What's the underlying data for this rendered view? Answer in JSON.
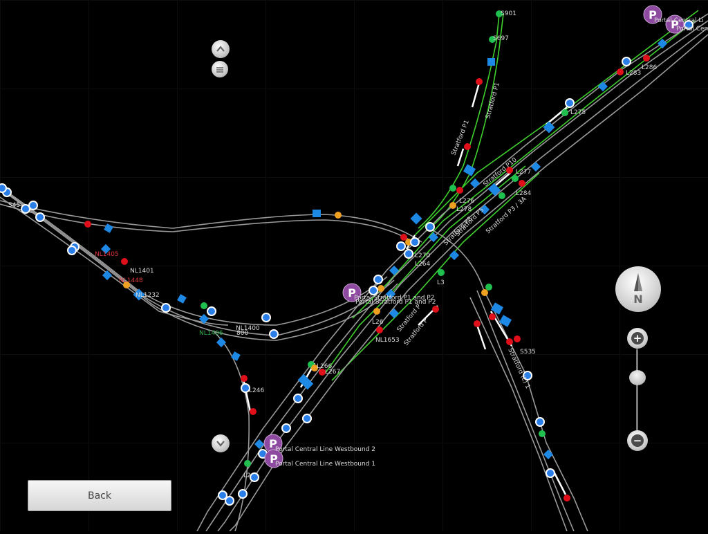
{
  "map": {
    "labels": {
      "s901": "S901",
      "s697": "S697",
      "stratford_p1_a": "Stratford P1",
      "stratford_p1_b": "Stratford P1",
      "l286": "L286",
      "l283": "L283",
      "l275": "L275",
      "l277": "L277",
      "l284": "L284",
      "l276": "L276",
      "l278": "L278",
      "stratford_p10": "Stratford P10",
      "stratford_p8": "Stratford P8",
      "stratford_p5": "Stratford P5",
      "stratford_p3": "Stratford P3 / 3A",
      "l270": "L270",
      "l264": "L264",
      "l3": "L3",
      "portal_stratford_1": "Portal Stratford P1 and P2",
      "portal_stratford_2": "Portal Stratford P1 and P2",
      "l26": "L26",
      "nl1653": "NL1653",
      "stratford_p_low_1": "Stratford P",
      "stratford_p_low_2": "Stratford P",
      "s535": "S535",
      "nl1401": "NL1401",
      "nl1232": "NL1232",
      "nl1405": "NL1405",
      "nl1406": "NL1406",
      "nl1448": "NL1448",
      "nl1400": "NL1400",
      "n800": "800",
      "s45": "S45",
      "l246": "L246",
      "l266": "L266",
      "l267": "L267",
      "portal_cl_wb2": "Portal Central Line Westbound 2",
      "portal_cl_wb1": "Portal Central Line Westbound 1",
      "portal_central_1": "Portal Central Li",
      "portal_central_2": "Portal Cen",
      "l2": "L2",
      "ll_x": "Stratford (L) 1"
    },
    "colors": {
      "track": "#9a9a9a",
      "electrified_track": "#3fd02e",
      "signal_red": "#e0101a",
      "signal_green": "#20c050",
      "signal_orange": "#f0a020",
      "point_blue": "#1e88e5",
      "portal_purple": "#8e4aa0"
    },
    "portal_glyph": "P"
  },
  "controls": {
    "compass_letter": "N",
    "zoom_in_glyph": "+",
    "zoom_out_glyph": "−",
    "back_label": "Back"
  }
}
